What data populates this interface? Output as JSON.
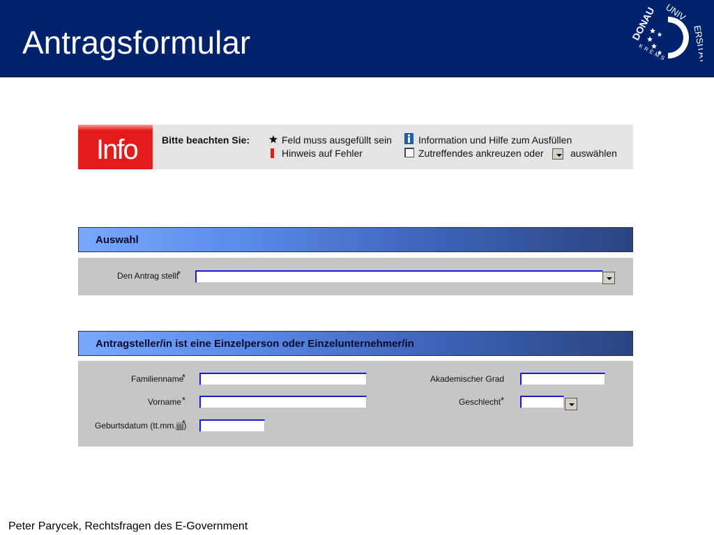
{
  "header": {
    "title": "Antragsformular"
  },
  "logo": {
    "arc_top": "DONAU UNIVERSITÄT",
    "arc_bottom": "KREMS",
    "colors": {
      "background": "#00216b",
      "foreground": "#ffffff"
    }
  },
  "info_panel": {
    "badge": "Info",
    "heading": "Bitte beachten Sie:",
    "legend": [
      {
        "icon": "asterisk-icon",
        "text": "Feld muss ausgefüllt sein"
      },
      {
        "icon": "exclamation-icon",
        "text": "Hinweis auf Fehler"
      },
      {
        "icon": "info-icon",
        "text": "Information und Hilfe zum Ausfüllen"
      },
      {
        "icon": "checkbox-icon",
        "text": "Zutreffendes ankreuzen oder"
      },
      {
        "icon": "dropdown-icon",
        "text": "auswählen"
      }
    ]
  },
  "section_auswahl": {
    "title": "Auswahl",
    "fields": [
      {
        "label": "Den Antrag stellt",
        "required": "*",
        "value": ""
      }
    ]
  },
  "section_person": {
    "title": "Antragsteller/in ist eine Einzelperson oder Einzelunternehmer/in",
    "fields": {
      "familienname": {
        "label": "Familienname",
        "required": "*",
        "value": ""
      },
      "vorname": {
        "label": "Vorname",
        "required": "*",
        "value": ""
      },
      "geburtsdatum": {
        "label": "Geburtsdatum (tt.mm.jjjj)",
        "required": "*",
        "value": ""
      },
      "grad": {
        "label": "Akademischer Grad",
        "value": ""
      },
      "geschlecht": {
        "label": "Geschlecht",
        "required": "*",
        "value": ""
      }
    }
  },
  "footer": {
    "text": "Peter Parycek, Rechtsfragen des E-Government"
  },
  "colors": {
    "header": "#00216b",
    "info_badge": "#e31b1b",
    "section_bar_start": "#79a8ff",
    "section_bar_end": "#2a4580",
    "section_body": "#c6c6c6",
    "field_border": "#1a1ad0"
  }
}
